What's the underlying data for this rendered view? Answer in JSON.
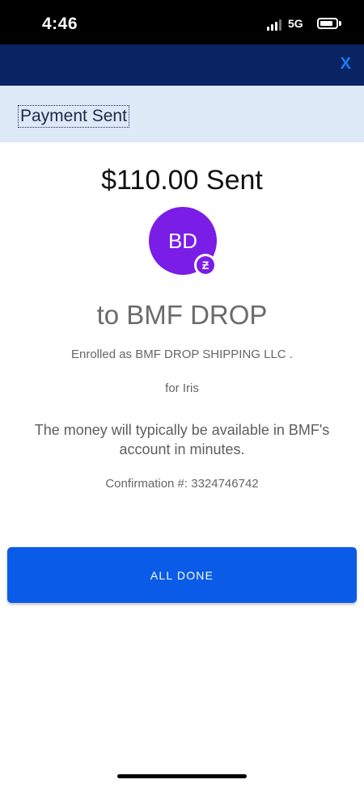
{
  "status_bar": {
    "time": "4:46",
    "network": "5G",
    "icons": [
      "signal-icon",
      "battery-icon"
    ]
  },
  "header": {
    "close_label": "X",
    "color": "#0a2463",
    "close_color": "#1d7cf2"
  },
  "title": "Payment Sent",
  "payment": {
    "amount_text": "$110.00 Sent",
    "avatar_initials": "BD",
    "avatar_color": "#7a1de6",
    "badge_icon": "zelle-icon",
    "badge_glyph": "Ƶ",
    "recipient": "to BMF DROP",
    "enrolled": "Enrolled as BMF DROP SHIPPING LLC .",
    "memo": "for Iris",
    "availability": "The money will typically be available in BMF's account in minutes.",
    "confirmation": "Confirmation #: 3324746742"
  },
  "actions": {
    "done_label": "ALL DONE",
    "done_color": "#0a5be8"
  }
}
